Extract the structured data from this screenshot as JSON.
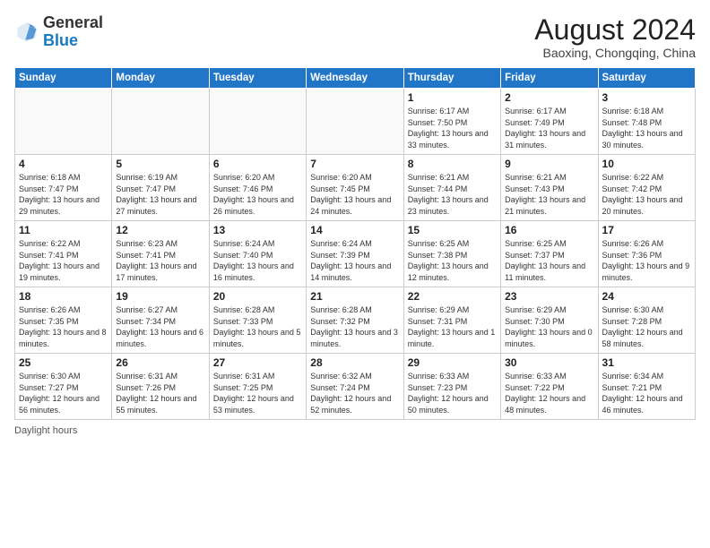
{
  "header": {
    "logo_general": "General",
    "logo_blue": "Blue",
    "month_year": "August 2024",
    "location": "Baoxing, Chongqing, China"
  },
  "weekdays": [
    "Sunday",
    "Monday",
    "Tuesday",
    "Wednesday",
    "Thursday",
    "Friday",
    "Saturday"
  ],
  "footer_label": "Daylight hours",
  "weeks": [
    [
      {
        "day": "",
        "info": ""
      },
      {
        "day": "",
        "info": ""
      },
      {
        "day": "",
        "info": ""
      },
      {
        "day": "",
        "info": ""
      },
      {
        "day": "1",
        "info": "Sunrise: 6:17 AM\nSunset: 7:50 PM\nDaylight: 13 hours\nand 33 minutes."
      },
      {
        "day": "2",
        "info": "Sunrise: 6:17 AM\nSunset: 7:49 PM\nDaylight: 13 hours\nand 31 minutes."
      },
      {
        "day": "3",
        "info": "Sunrise: 6:18 AM\nSunset: 7:48 PM\nDaylight: 13 hours\nand 30 minutes."
      }
    ],
    [
      {
        "day": "4",
        "info": "Sunrise: 6:18 AM\nSunset: 7:47 PM\nDaylight: 13 hours\nand 29 minutes."
      },
      {
        "day": "5",
        "info": "Sunrise: 6:19 AM\nSunset: 7:47 PM\nDaylight: 13 hours\nand 27 minutes."
      },
      {
        "day": "6",
        "info": "Sunrise: 6:20 AM\nSunset: 7:46 PM\nDaylight: 13 hours\nand 26 minutes."
      },
      {
        "day": "7",
        "info": "Sunrise: 6:20 AM\nSunset: 7:45 PM\nDaylight: 13 hours\nand 24 minutes."
      },
      {
        "day": "8",
        "info": "Sunrise: 6:21 AM\nSunset: 7:44 PM\nDaylight: 13 hours\nand 23 minutes."
      },
      {
        "day": "9",
        "info": "Sunrise: 6:21 AM\nSunset: 7:43 PM\nDaylight: 13 hours\nand 21 minutes."
      },
      {
        "day": "10",
        "info": "Sunrise: 6:22 AM\nSunset: 7:42 PM\nDaylight: 13 hours\nand 20 minutes."
      }
    ],
    [
      {
        "day": "11",
        "info": "Sunrise: 6:22 AM\nSunset: 7:41 PM\nDaylight: 13 hours\nand 19 minutes."
      },
      {
        "day": "12",
        "info": "Sunrise: 6:23 AM\nSunset: 7:41 PM\nDaylight: 13 hours\nand 17 minutes."
      },
      {
        "day": "13",
        "info": "Sunrise: 6:24 AM\nSunset: 7:40 PM\nDaylight: 13 hours\nand 16 minutes."
      },
      {
        "day": "14",
        "info": "Sunrise: 6:24 AM\nSunset: 7:39 PM\nDaylight: 13 hours\nand 14 minutes."
      },
      {
        "day": "15",
        "info": "Sunrise: 6:25 AM\nSunset: 7:38 PM\nDaylight: 13 hours\nand 12 minutes."
      },
      {
        "day": "16",
        "info": "Sunrise: 6:25 AM\nSunset: 7:37 PM\nDaylight: 13 hours\nand 11 minutes."
      },
      {
        "day": "17",
        "info": "Sunrise: 6:26 AM\nSunset: 7:36 PM\nDaylight: 13 hours\nand 9 minutes."
      }
    ],
    [
      {
        "day": "18",
        "info": "Sunrise: 6:26 AM\nSunset: 7:35 PM\nDaylight: 13 hours\nand 8 minutes."
      },
      {
        "day": "19",
        "info": "Sunrise: 6:27 AM\nSunset: 7:34 PM\nDaylight: 13 hours\nand 6 minutes."
      },
      {
        "day": "20",
        "info": "Sunrise: 6:28 AM\nSunset: 7:33 PM\nDaylight: 13 hours\nand 5 minutes."
      },
      {
        "day": "21",
        "info": "Sunrise: 6:28 AM\nSunset: 7:32 PM\nDaylight: 13 hours\nand 3 minutes."
      },
      {
        "day": "22",
        "info": "Sunrise: 6:29 AM\nSunset: 7:31 PM\nDaylight: 13 hours\nand 1 minute."
      },
      {
        "day": "23",
        "info": "Sunrise: 6:29 AM\nSunset: 7:30 PM\nDaylight: 13 hours\nand 0 minutes."
      },
      {
        "day": "24",
        "info": "Sunrise: 6:30 AM\nSunset: 7:28 PM\nDaylight: 12 hours\nand 58 minutes."
      }
    ],
    [
      {
        "day": "25",
        "info": "Sunrise: 6:30 AM\nSunset: 7:27 PM\nDaylight: 12 hours\nand 56 minutes."
      },
      {
        "day": "26",
        "info": "Sunrise: 6:31 AM\nSunset: 7:26 PM\nDaylight: 12 hours\nand 55 minutes."
      },
      {
        "day": "27",
        "info": "Sunrise: 6:31 AM\nSunset: 7:25 PM\nDaylight: 12 hours\nand 53 minutes."
      },
      {
        "day": "28",
        "info": "Sunrise: 6:32 AM\nSunset: 7:24 PM\nDaylight: 12 hours\nand 52 minutes."
      },
      {
        "day": "29",
        "info": "Sunrise: 6:33 AM\nSunset: 7:23 PM\nDaylight: 12 hours\nand 50 minutes."
      },
      {
        "day": "30",
        "info": "Sunrise: 6:33 AM\nSunset: 7:22 PM\nDaylight: 12 hours\nand 48 minutes."
      },
      {
        "day": "31",
        "info": "Sunrise: 6:34 AM\nSunset: 7:21 PM\nDaylight: 12 hours\nand 46 minutes."
      }
    ]
  ]
}
